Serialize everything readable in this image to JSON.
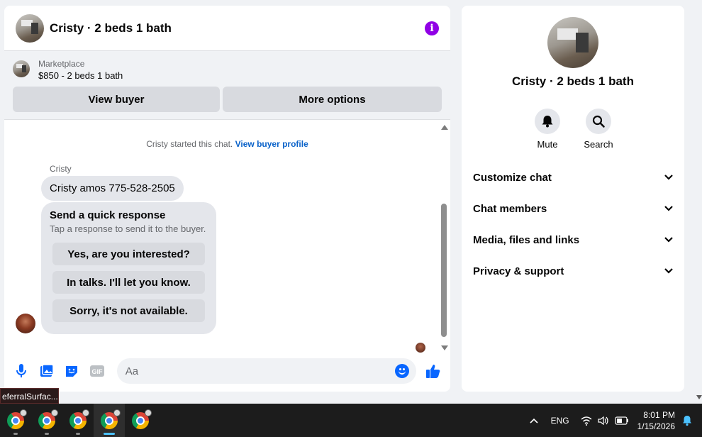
{
  "chat": {
    "title": "Cristy · 2 beds 1 bath",
    "marketplace_label": "Marketplace",
    "listing": "$850 - 2 beds 1 bath",
    "view_buyer": "View buyer",
    "more_options": "More options",
    "started_text": "Cristy started this chat.",
    "view_buyer_profile": "View buyer profile",
    "sender_name": "Cristy",
    "message": "Cristy amos 775-528-2505",
    "quick_title": "Send a quick response",
    "quick_subtitle": "Tap a response to send it to the buyer.",
    "quick_responses": [
      "Yes, are you interested?",
      "In talks. I'll let you know.",
      "Sorry, it's not available."
    ],
    "input_placeholder": "Aa"
  },
  "info_panel": {
    "title": "Cristy · 2 beds 1 bath",
    "mute": "Mute",
    "search": "Search",
    "sections": [
      "Customize chat",
      "Chat members",
      "Media, files and links",
      "Privacy & support"
    ]
  },
  "tooltip": "eferralSurfac...",
  "taskbar": {
    "language": "ENG",
    "time": "8:01 PM",
    "date": "1/15/2026"
  },
  "colors": {
    "accent": "#0866ff",
    "info_icon": "#9000e5",
    "link": "#0a62c9"
  }
}
